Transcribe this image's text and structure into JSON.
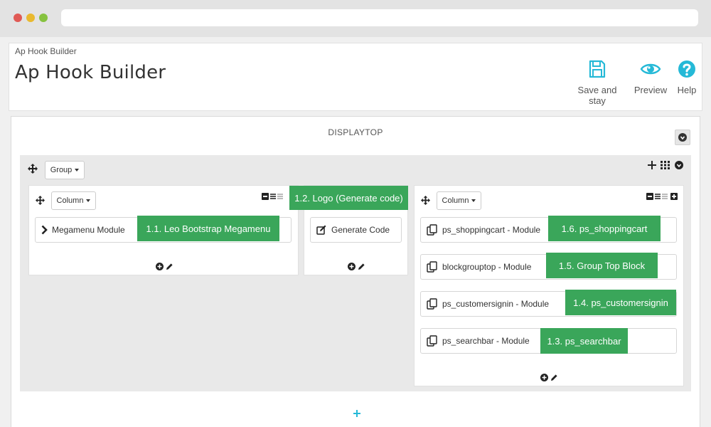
{
  "breadcrumb": "Ap Hook Builder",
  "page_title": "Ap Hook Builder",
  "toolbar": {
    "save_label": "Save and stay",
    "preview_label": "Preview",
    "help_label": "Help"
  },
  "hook": {
    "title": "DISPLAYTOP",
    "group_dropdown": "Group",
    "columns": [
      {
        "dropdown": "Column",
        "modules": [
          {
            "name": "Megamenu Module",
            "callout": "1.1. Leo Bootstrap Megamenu"
          }
        ]
      },
      {
        "callout": "1.2. Logo (Generate code)",
        "modules": [
          {
            "name": "Generate Code"
          }
        ]
      },
      {
        "dropdown": "Column",
        "modules": [
          {
            "name": "ps_shoppingcart - Module",
            "callout": "1.6. ps_shoppingcart"
          },
          {
            "name": "blockgrouptop - Module",
            "callout": "1.5. Group Top Block"
          },
          {
            "name": "ps_customersignin - Module",
            "callout": "1.4. ps_customersignin"
          },
          {
            "name": "ps_searchbar - Module",
            "callout": "1.3. ps_searchbar"
          }
        ]
      }
    ]
  },
  "colors": {
    "accent": "#25b9d7",
    "callout": "#3aa65a"
  }
}
